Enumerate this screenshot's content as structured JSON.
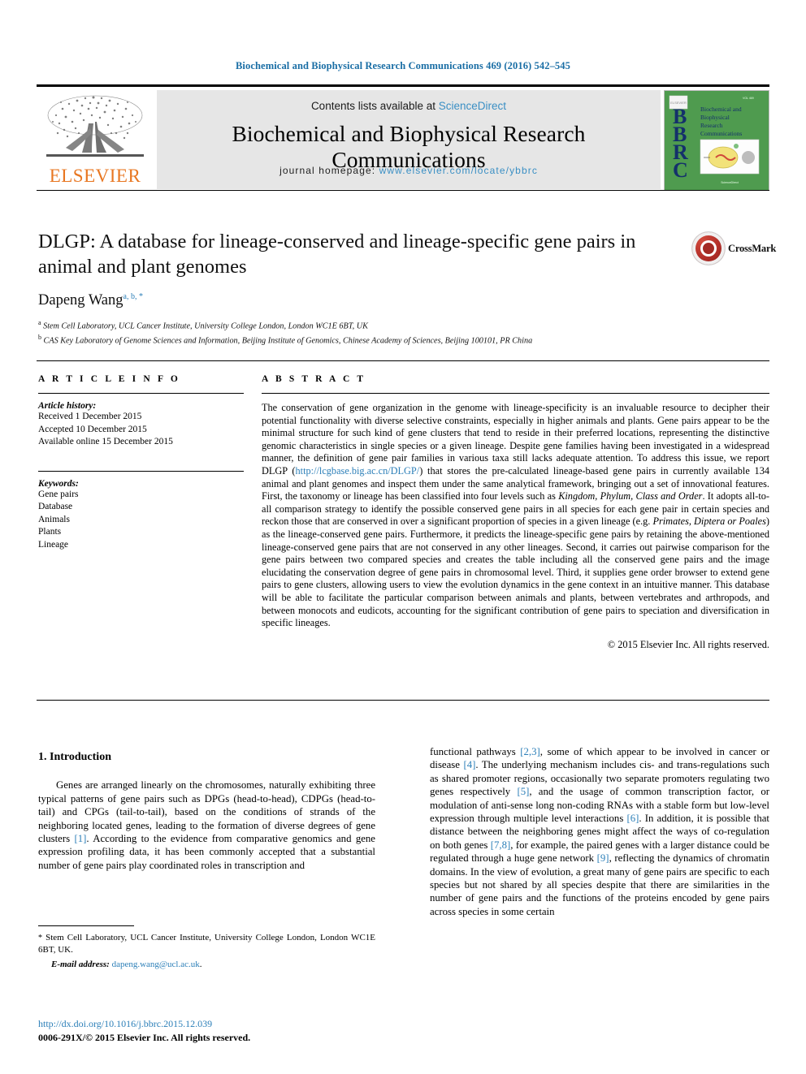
{
  "running_head": "Biochemical and Biophysical Research Communications 469 (2016) 542–545",
  "masthead": {
    "publisher_name": "ELSEVIER",
    "contents_prefix": "Contents lists available at ",
    "contents_link": "ScienceDirect",
    "journal_title": "Biochemical and Biophysical Research Communications",
    "homepage_prefix": "journal homepage: ",
    "homepage_url": "www.elsevier.com/locate/ybbrc",
    "cover": {
      "line1": "Biochemical and",
      "line2": "Biophysical",
      "line3": "Research",
      "line4": "Communications",
      "acronym": "BBRC",
      "bg_color": "#4f9b4f"
    }
  },
  "article": {
    "title": "DLGP: A database for lineage-conserved and lineage-specific gene pairs in animal and plant genomes",
    "author_name": "Dapeng Wang",
    "author_marks": "a, b, *",
    "affiliations": [
      {
        "mark": "a",
        "text": "Stem Cell Laboratory, UCL Cancer Institute, University College London, London WC1E 6BT, UK"
      },
      {
        "mark": "b",
        "text": "CAS Key Laboratory of Genome Sciences and Information, Beijing Institute of Genomics, Chinese Academy of Sciences, Beijing 100101, PR China"
      }
    ],
    "crossmark_label": "CrossMark"
  },
  "article_info": {
    "heading": "A R T I C L E   I N F O",
    "history_label": "Article history:",
    "history": [
      "Received 1 December 2015",
      "Accepted 10 December 2015",
      "Available online 15 December 2015"
    ],
    "keywords_label": "Keywords:",
    "keywords": [
      "Gene pairs",
      "Database",
      "Animals",
      "Plants",
      "Lineage"
    ]
  },
  "abstract": {
    "heading": "A B S T R A C T",
    "p1": "The conservation of gene organization in the genome with lineage-specificity is an invaluable resource to decipher their potential functionality with diverse selective constraints, especially in higher animals and plants. Gene pairs appear to be the minimal structure for such kind of gene clusters that tend to reside in their preferred locations, representing the distinctive genomic characteristics in single species or a given lineage. Despite gene families having been investigated in a widespread manner, the definition of gene pair families in various taxa still lacks adequate attention. To address this issue, we report DLGP (",
    "url": "http://lcgbase.big.ac.cn/DLGP/",
    "p2_a": ") that stores the pre-calculated lineage-based gene pairs in currently available 134 animal and plant genomes and inspect them under the same analytical framework, bringing out a set of innovational features. First, the taxonomy or lineage has been classified into four levels such as ",
    "levels": "Kingdom, Phylum, Class and Order",
    "p2_b": ". It adopts all-to-all comparison strategy to identify the possible conserved gene pairs in all species for each gene pair in certain species and reckon those that are conserved in over a significant proportion of species in a given lineage (e.g. ",
    "lineage_examples": "Primates, Diptera or Poales",
    "p2_c": ") as the lineage-conserved gene pairs. Furthermore, it predicts the lineage-specific gene pairs by retaining the above-mentioned lineage-conserved gene pairs that are not conserved in any other lineages. Second, it carries out pairwise comparison for the gene pairs between two compared species and creates the table including all the conserved gene pairs and the image elucidating the conservation degree of gene pairs in chromosomal level. Third, it supplies gene order browser to extend gene pairs to gene clusters, allowing users to view the evolution dynamics in the gene context in an intuitive manner. This database will be able to facilitate the particular comparison between animals and plants, between vertebrates and arthropods, and between monocots and eudicots, accounting for the significant contribution of gene pairs to speciation and diversification in specific lineages.",
    "copyright": "© 2015 Elsevier Inc. All rights reserved."
  },
  "introduction": {
    "heading": "1. Introduction",
    "left_p1_a": "Genes are arranged linearly on the chromosomes, naturally exhibiting three typical patterns of gene pairs such as DPGs (head-to-head), CDPGs (head-to-tail) and CPGs (tail-to-tail), based on the conditions of strands of the neighboring located genes, leading to the formation of diverse degrees of gene clusters ",
    "ref1": "[1]",
    "left_p1_b": ". According to the evidence from comparative genomics and gene expression profiling data, it has been commonly accepted that a substantial number of gene pairs play coordinated roles in transcription and",
    "right_a": "functional pathways ",
    "ref23": "[2,3]",
    "right_b": ", some of which appear to be involved in cancer or disease ",
    "ref4": "[4]",
    "right_c": ". The underlying mechanism includes cis- and trans-regulations such as shared promoter regions, occasionally two separate promoters regulating two genes respectively ",
    "ref5": "[5]",
    "right_d": ", and the usage of common transcription factor, or modulation of anti-sense long non-coding RNAs with a stable form but low-level expression through multiple level interactions ",
    "ref6": "[6]",
    "right_e": ". In addition, it is possible that distance between the neighboring genes might affect the ways of co-regulation on both genes ",
    "ref78": "[7,8]",
    "right_f": ", for example, the paired genes with a larger distance could be regulated through a huge gene network ",
    "ref9": "[9]",
    "right_g": ", reflecting the dynamics of chromatin domains. In the view of evolution, a great many of gene pairs are specific to each species but not shared by all species despite that there are similarities in the number of gene pairs and the functions of the proteins encoded by gene pairs across species in some certain"
  },
  "footnote": {
    "star": "*",
    "corresponding": " Stem Cell Laboratory, UCL Cancer Institute, University College London, London WC1E 6BT, UK.",
    "email_label": "E-mail address:",
    "email": "dapeng.wang@ucl.ac.uk"
  },
  "footer": {
    "doi": "http://dx.doi.org/10.1016/j.bbrc.2015.12.039",
    "issn": "0006-291X/© 2015 Elsevier Inc. All rights reserved."
  },
  "colors": {
    "link": "#2c7fb8",
    "running_head": "#1a6ea5",
    "elsevier_orange": "#e87722",
    "cover_green": "#4f9b4f"
  }
}
